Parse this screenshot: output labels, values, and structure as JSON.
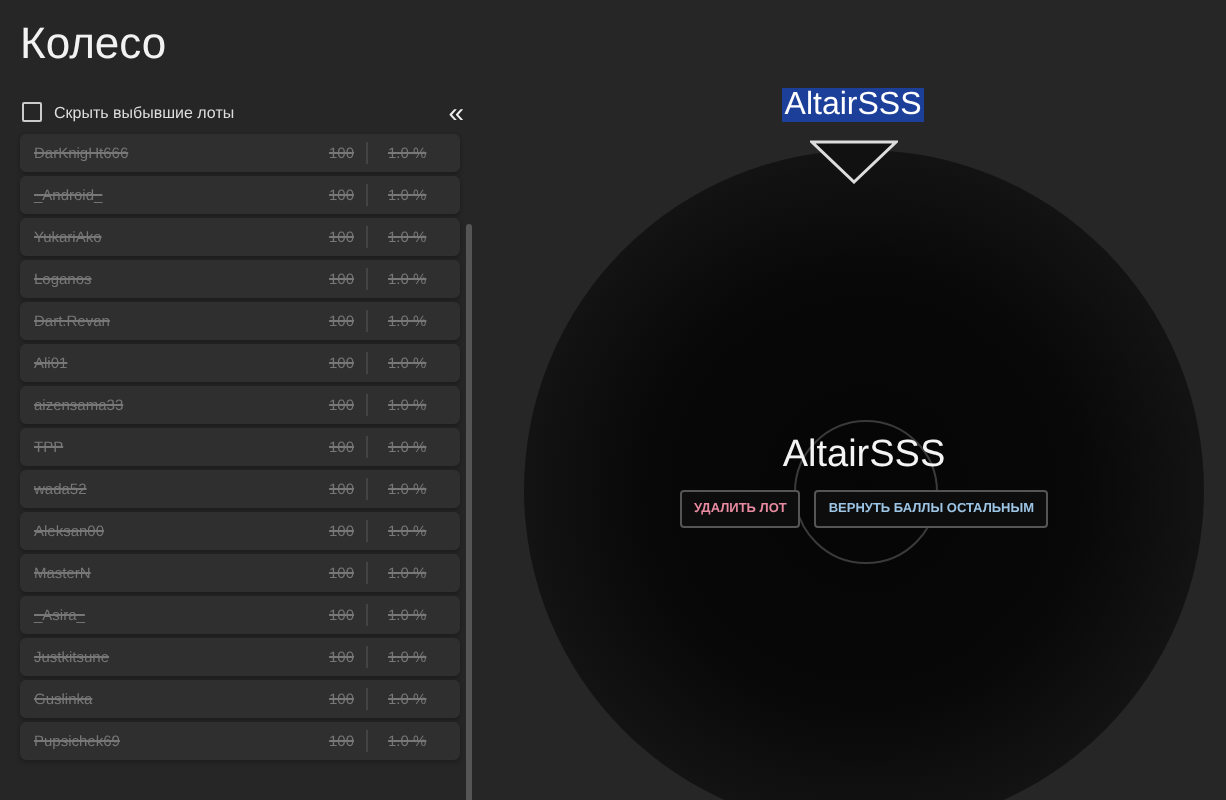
{
  "title": "Колесо",
  "hide_filter": {
    "label": "Скрыть выбывшие лоты",
    "checked": false
  },
  "collapse_button": "«",
  "lots": [
    {
      "name": "DarKnigHt666",
      "amount": "100",
      "chance": "1.0 %",
      "eliminated": true
    },
    {
      "name": "_Android_",
      "amount": "100",
      "chance": "1.0 %",
      "eliminated": true
    },
    {
      "name": "YukariAko",
      "amount": "100",
      "chance": "1.0 %",
      "eliminated": true
    },
    {
      "name": "Loganos",
      "amount": "100",
      "chance": "1.0 %",
      "eliminated": true
    },
    {
      "name": "Dart.Revan",
      "amount": "100",
      "chance": "1.0 %",
      "eliminated": true
    },
    {
      "name": "Ali01",
      "amount": "100",
      "chance": "1.0 %",
      "eliminated": true
    },
    {
      "name": "aizensama33",
      "amount": "100",
      "chance": "1.0 %",
      "eliminated": true
    },
    {
      "name": "TPP",
      "amount": "100",
      "chance": "1.0 %",
      "eliminated": true
    },
    {
      "name": "wada52",
      "amount": "100",
      "chance": "1.0 %",
      "eliminated": true
    },
    {
      "name": "Aleksan00",
      "amount": "100",
      "chance": "1.0 %",
      "eliminated": true
    },
    {
      "name": "MasterN",
      "amount": "100",
      "chance": "1.0 %",
      "eliminated": true
    },
    {
      "name": "_Asira_",
      "amount": "100",
      "chance": "1.0 %",
      "eliminated": true
    },
    {
      "name": "Justkitsune",
      "amount": "100",
      "chance": "1.0 %",
      "eliminated": true
    },
    {
      "name": "Guslinka",
      "amount": "100",
      "chance": "1.0 %",
      "eliminated": true
    },
    {
      "name": "Pupsichek69",
      "amount": "100",
      "chance": "1.0 %",
      "eliminated": true
    }
  ],
  "wheel": {
    "pointer_label": "AltairSSS",
    "winner": "AltairSSS",
    "buttons": [
      {
        "kind": "danger",
        "label": "УДАЛИТЬ ЛОТ"
      },
      {
        "kind": "info",
        "label": "ВЕРНУТЬ БАЛЛЫ ОСТАЛЬНЫМ"
      }
    ]
  }
}
